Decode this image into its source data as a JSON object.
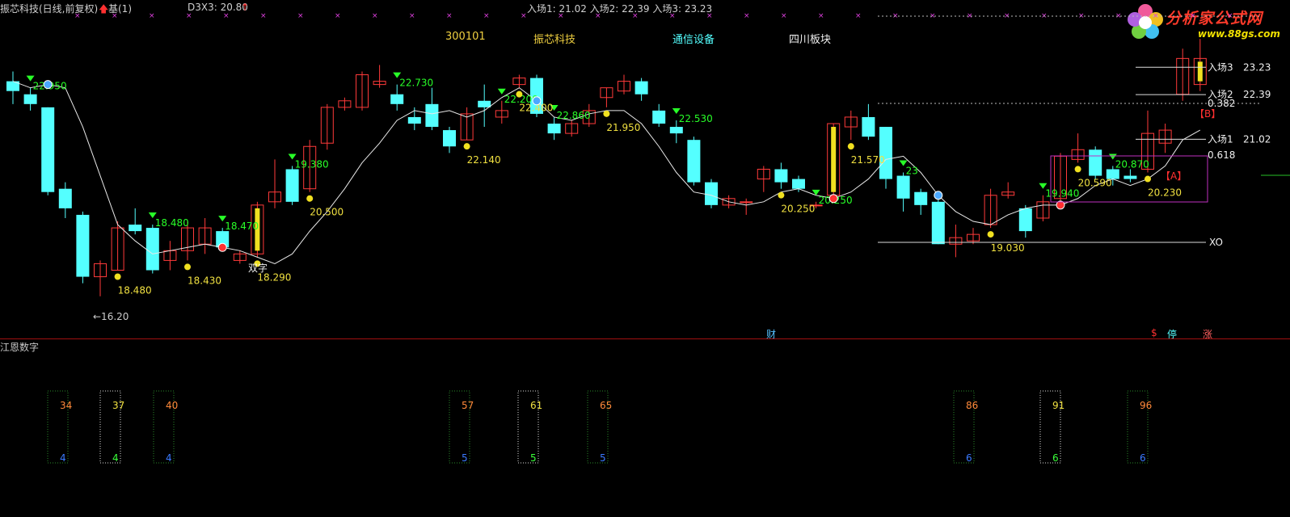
{
  "header": {
    "title": "振芯科技(日线,前复权)",
    "base_label": "基(1)",
    "d3x3": "D3X3: 20.80",
    "entries": "入场1: 21.02  入场2: 22.39  入场3: 23.23"
  },
  "info": {
    "code": "300101",
    "name": "振芯科技",
    "industry": "通信设备",
    "region": "四川板块"
  },
  "watermark": {
    "title": "分析家公式网",
    "url": "www.88gs.com"
  },
  "colors": {
    "up": "#ff3a3a",
    "down": "#54ffff",
    "ma": "#e8e8e8",
    "signal_green": "#28ff28",
    "label_yellow": "#f0e040",
    "grid_red": "#a01010"
  },
  "chart_data": {
    "type": "candlestick",
    "price_range": [
      15.5,
      24.6
    ],
    "candles": [
      {
        "o": 22.8,
        "c": 22.5,
        "h": 23.1,
        "l": 22.1
      },
      {
        "o": 22.4,
        "c": 22.1,
        "h": 22.6,
        "l": 21.9
      },
      {
        "o": 22.0,
        "c": 19.4,
        "h": 22.0,
        "l": 19.3
      },
      {
        "o": 19.5,
        "c": 18.9,
        "h": 19.7,
        "l": 18.6
      },
      {
        "o": 18.7,
        "c": 16.8,
        "h": 18.8,
        "l": 16.6
      },
      {
        "o": 16.8,
        "c": 17.2,
        "h": 17.3,
        "l": 16.2
      },
      {
        "o": 17.0,
        "c": 18.3,
        "h": 18.5,
        "l": 17.0
      },
      {
        "o": 18.4,
        "c": 18.2,
        "h": 18.9,
        "l": 18.1
      },
      {
        "o": 18.3,
        "c": 17.0,
        "h": 18.4,
        "l": 16.9
      },
      {
        "o": 17.3,
        "c": 17.6,
        "h": 17.9,
        "l": 17.0
      },
      {
        "o": 17.6,
        "c": 18.3,
        "h": 18.5,
        "l": 17.3
      },
      {
        "o": 17.8,
        "c": 18.3,
        "h": 18.6,
        "l": 17.5
      },
      {
        "o": 18.2,
        "c": 17.7,
        "h": 18.3,
        "l": 17.6
      },
      {
        "o": 17.3,
        "c": 17.5,
        "h": 17.6,
        "l": 17.2
      },
      {
        "o": 17.5,
        "c": 19.0,
        "h": 19.1,
        "l": 17.4
      },
      {
        "o": 19.1,
        "c": 19.4,
        "h": 20.4,
        "l": 18.9
      },
      {
        "o": 20.1,
        "c": 19.1,
        "h": 20.2,
        "l": 19.0
      },
      {
        "o": 19.5,
        "c": 20.8,
        "h": 21.0,
        "l": 19.4
      },
      {
        "o": 20.9,
        "c": 22.0,
        "h": 22.1,
        "l": 20.7
      },
      {
        "o": 22.0,
        "c": 22.2,
        "h": 22.3,
        "l": 21.9
      },
      {
        "o": 22.0,
        "c": 23.0,
        "h": 23.1,
        "l": 21.9
      },
      {
        "o": 22.7,
        "c": 22.8,
        "h": 23.3,
        "l": 22.6
      },
      {
        "o": 22.4,
        "c": 22.1,
        "h": 22.7,
        "l": 21.9
      },
      {
        "o": 21.7,
        "c": 21.5,
        "h": 22.0,
        "l": 21.3
      },
      {
        "o": 22.1,
        "c": 21.4,
        "h": 22.6,
        "l": 21.3
      },
      {
        "o": 21.3,
        "c": 20.8,
        "h": 21.4,
        "l": 20.6
      },
      {
        "o": 21.0,
        "c": 21.8,
        "h": 22.0,
        "l": 21.0
      },
      {
        "o": 22.2,
        "c": 22.0,
        "h": 22.7,
        "l": 21.4
      },
      {
        "o": 21.7,
        "c": 21.9,
        "h": 22.2,
        "l": 21.5
      },
      {
        "o": 22.7,
        "c": 22.9,
        "h": 23.0,
        "l": 22.6
      },
      {
        "o": 22.9,
        "c": 21.8,
        "h": 23.0,
        "l": 21.7
      },
      {
        "o": 21.5,
        "c": 21.2,
        "h": 21.7,
        "l": 21.0
      },
      {
        "o": 21.2,
        "c": 21.5,
        "h": 21.6,
        "l": 21.1
      },
      {
        "o": 21.5,
        "c": 21.9,
        "h": 22.1,
        "l": 21.4
      },
      {
        "o": 22.3,
        "c": 22.6,
        "h": 22.6,
        "l": 22.0
      },
      {
        "o": 22.5,
        "c": 22.8,
        "h": 23.0,
        "l": 22.4
      },
      {
        "o": 22.8,
        "c": 22.4,
        "h": 22.9,
        "l": 22.2
      },
      {
        "o": 21.9,
        "c": 21.5,
        "h": 22.1,
        "l": 21.4
      },
      {
        "o": 21.4,
        "c": 21.2,
        "h": 21.6,
        "l": 20.9
      },
      {
        "o": 21.0,
        "c": 19.7,
        "h": 21.1,
        "l": 19.6
      },
      {
        "o": 19.7,
        "c": 19.0,
        "h": 19.8,
        "l": 18.9
      },
      {
        "o": 19.0,
        "c": 19.2,
        "h": 19.3,
        "l": 18.9
      },
      {
        "o": 19.1,
        "c": 19.1,
        "h": 19.2,
        "l": 18.7
      },
      {
        "o": 19.8,
        "c": 20.1,
        "h": 20.2,
        "l": 19.4
      },
      {
        "o": 20.1,
        "c": 19.7,
        "h": 20.3,
        "l": 19.5
      },
      {
        "o": 19.8,
        "c": 19.5,
        "h": 19.9,
        "l": 19.4
      },
      {
        "o": 19.0,
        "c": 19.0,
        "h": 19.1,
        "l": 18.9
      },
      {
        "o": 19.3,
        "c": 21.5,
        "h": 21.5,
        "l": 19.2
      },
      {
        "o": 21.4,
        "c": 21.7,
        "h": 21.9,
        "l": 21.0
      },
      {
        "o": 21.7,
        "c": 21.1,
        "h": 22.1,
        "l": 21.0
      },
      {
        "o": 21.4,
        "c": 19.8,
        "h": 21.4,
        "l": 19.5
      },
      {
        "o": 19.9,
        "c": 19.2,
        "h": 20.0,
        "l": 18.8
      },
      {
        "o": 19.4,
        "c": 19.0,
        "h": 19.5,
        "l": 18.7
      },
      {
        "o": 19.1,
        "c": 17.8,
        "h": 19.2,
        "l": 17.8
      },
      {
        "o": 17.8,
        "c": 18.0,
        "h": 18.4,
        "l": 17.4
      },
      {
        "o": 17.9,
        "c": 18.1,
        "h": 18.3,
        "l": 17.8
      },
      {
        "o": 18.4,
        "c": 19.3,
        "h": 19.5,
        "l": 18.3
      },
      {
        "o": 19.3,
        "c": 19.4,
        "h": 19.7,
        "l": 19.2
      },
      {
        "o": 18.9,
        "c": 18.2,
        "h": 19.0,
        "l": 18.0
      },
      {
        "o": 18.6,
        "c": 19.1,
        "h": 19.3,
        "l": 18.5
      },
      {
        "o": 19.2,
        "c": 20.5,
        "h": 20.6,
        "l": 19.1
      },
      {
        "o": 20.4,
        "c": 20.7,
        "h": 21.2,
        "l": 20.3
      },
      {
        "o": 20.7,
        "c": 19.9,
        "h": 20.8,
        "l": 19.8
      },
      {
        "o": 20.1,
        "c": 19.8,
        "h": 20.2,
        "l": 19.6
      },
      {
        "o": 19.9,
        "c": 19.8,
        "h": 20.1,
        "l": 19.7
      },
      {
        "o": 20.1,
        "c": 21.2,
        "h": 21.9,
        "l": 20.0
      },
      {
        "o": 20.9,
        "c": 21.3,
        "h": 21.5,
        "l": 20.6
      },
      {
        "o": 22.4,
        "c": 23.5,
        "h": 23.8,
        "l": 22.2
      },
      {
        "o": 22.7,
        "c": 23.5,
        "h": 24.1,
        "l": 22.5
      }
    ],
    "ma_line": [
      22.8,
      22.6,
      22.7,
      22.6,
      21.4,
      19.9,
      18.4,
      17.9,
      17.5,
      17.6,
      17.7,
      17.8,
      17.7,
      17.6,
      17.4,
      17.2,
      17.5,
      18.2,
      18.8,
      19.5,
      20.3,
      20.9,
      21.6,
      21.9,
      21.8,
      21.9,
      21.7,
      21.9,
      22.3,
      22.6,
      22.2,
      21.7,
      21.6,
      21.8,
      21.9,
      21.9,
      21.5,
      20.8,
      20.0,
      19.4,
      19.3,
      19.1,
      19.0,
      19.1,
      19.4,
      19.5,
      19.3,
      19.2,
      19.4,
      19.8,
      20.4,
      20.5,
      20.0,
      19.3,
      18.8,
      18.5,
      18.4,
      18.7,
      18.9,
      19.0,
      19.0,
      19.2,
      19.6,
      19.8,
      19.6,
      19.8,
      20.2,
      21.0,
      21.3
    ],
    "up_arrow_labels": [
      {
        "i": 1,
        "text": "22.950"
      },
      {
        "i": 8,
        "text": "18.480"
      },
      {
        "i": 12,
        "text": "18.470"
      },
      {
        "i": 16,
        "text": "19.380"
      },
      {
        "i": 22,
        "text": "22.730"
      },
      {
        "i": 28,
        "text": "22.200"
      },
      {
        "i": 31,
        "text": "22.860"
      },
      {
        "i": 38,
        "text": "22.530"
      },
      {
        "i": 46,
        "text": "20.250"
      },
      {
        "i": 51,
        "text": "23"
      },
      {
        "i": 59,
        "text": "19.940"
      },
      {
        "i": 63,
        "text": "20.870"
      }
    ],
    "low_labels": [
      {
        "i": 6,
        "text": "18.480"
      },
      {
        "i": 10,
        "text": "18.430"
      },
      {
        "i": 14,
        "text": "18.290"
      },
      {
        "i": 17,
        "text": "20.500"
      },
      {
        "i": 26,
        "text": "22.140"
      },
      {
        "i": 29,
        "text": "22.400"
      },
      {
        "i": 34,
        "text": "21.950"
      },
      {
        "i": 44,
        "text": "20.250"
      },
      {
        "i": 48,
        "text": "21.570"
      },
      {
        "i": 56,
        "text": "19.030"
      },
      {
        "i": 61,
        "text": "20.590"
      },
      {
        "i": 65,
        "text": "20.230"
      }
    ],
    "low_marker": "←16.20",
    "shuangzi": "双字",
    "right_axis": [
      {
        "label": "入场3",
        "value": 23.23
      },
      {
        "label": "入场2",
        "value": 22.39
      },
      {
        "label": "入场1",
        "value": 21.02
      }
    ],
    "right_annotations": [
      "0.382",
      "0.618",
      "XO",
      "【B】",
      "【A】"
    ],
    "bottom_markers": [
      "财",
      "$",
      "停",
      "涨"
    ]
  },
  "sub_chart": {
    "title": "江恩数字",
    "boxes": [
      {
        "top": "34",
        "bottom": "4",
        "top_color": "#ff8a3a",
        "bottom_color": "#3a7aff",
        "border": "#2a8a2a"
      },
      {
        "top": "37",
        "bottom": "4",
        "top_color": "#f0e040",
        "bottom_color": "#3aff3a",
        "border": "#e0e0e0"
      },
      {
        "top": "40",
        "bottom": "4",
        "top_color": "#ff8a3a",
        "bottom_color": "#3a7aff",
        "border": "#2a8a2a"
      },
      {
        "top": "57",
        "bottom": "5",
        "top_color": "#ff8a3a",
        "bottom_color": "#3a7aff",
        "border": "#2a8a2a"
      },
      {
        "top": "61",
        "bottom": "5",
        "top_color": "#f0e040",
        "bottom_color": "#3aff3a",
        "border": "#e0e0e0"
      },
      {
        "top": "65",
        "bottom": "5",
        "top_color": "#ff8a3a",
        "bottom_color": "#3a7aff",
        "border": "#2a8a2a"
      },
      {
        "top": "86",
        "bottom": "6",
        "top_color": "#ff8a3a",
        "bottom_color": "#3a7aff",
        "border": "#2a8a2a"
      },
      {
        "top": "91",
        "bottom": "6",
        "top_color": "#f0e040",
        "bottom_color": "#3aff3a",
        "border": "#e0e0e0"
      },
      {
        "top": "96",
        "bottom": "6",
        "top_color": "#ff8a3a",
        "bottom_color": "#3a7aff",
        "border": "#2a8a2a"
      }
    ]
  }
}
